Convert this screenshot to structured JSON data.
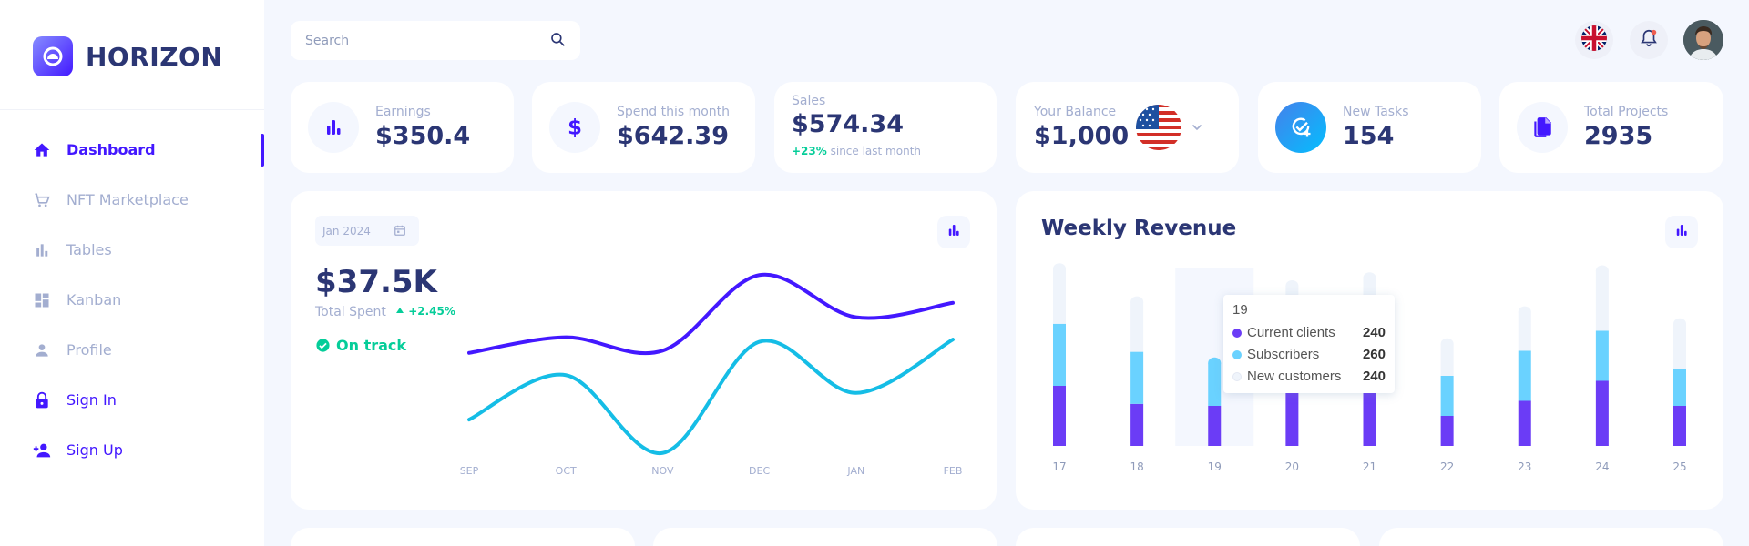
{
  "brand": {
    "name": "HORIZON"
  },
  "sidebar": {
    "items": [
      {
        "label": "Dashboard",
        "icon": "home-icon"
      },
      {
        "label": "NFT Marketplace",
        "icon": "cart-icon"
      },
      {
        "label": "Tables",
        "icon": "bar-chart-icon"
      },
      {
        "label": "Kanban",
        "icon": "dashboard-icon"
      },
      {
        "label": "Profile",
        "icon": "person-icon"
      },
      {
        "label": "Sign In",
        "icon": "lock-icon"
      },
      {
        "label": "Sign Up",
        "icon": "person-add-icon"
      }
    ],
    "active": "Dashboard"
  },
  "header": {
    "search_placeholder": "Search"
  },
  "stats": [
    {
      "label": "Earnings",
      "value": "$350.4",
      "icon": "bar-chart-icon"
    },
    {
      "label": "Spend this month",
      "value": "$642.39",
      "icon": "dollar-icon"
    },
    {
      "label": "Sales",
      "value": "$574.34",
      "change": "+23%",
      "change_text": "since last month"
    },
    {
      "label": "Your Balance",
      "value": "$1,000",
      "icon": "us-flag-icon"
    },
    {
      "label": "New Tasks",
      "value": "154",
      "icon": "task-add-icon"
    },
    {
      "label": "Total Projects",
      "value": "2935",
      "icon": "file-copy-icon"
    }
  ],
  "total_spent": {
    "date": "Jan 2024",
    "value": "$37.5K",
    "label": "Total Spent",
    "change": "+2.45%",
    "status": "On track"
  },
  "weekly_revenue": {
    "title": "Weekly Revenue",
    "tooltip": {
      "title": "19",
      "rows": [
        {
          "name": "Current clients",
          "value": "240"
        },
        {
          "name": "Subscribers",
          "value": "260"
        },
        {
          "name": "New customers",
          "value": "240"
        }
      ]
    }
  },
  "colors": {
    "primary": "#4318ff",
    "line_cyan": "#15bde6",
    "bar_purple": "#6b3cf6",
    "bar_cyan": "#6ad2ff",
    "bar_light": "#eff4fb",
    "success": "#05cd99",
    "text": "#2b3674",
    "muted": "#a3aed0"
  },
  "chart_data": [
    {
      "type": "line",
      "categories": [
        "SEP",
        "OCT",
        "NOV",
        "DEC",
        "JAN",
        "FEB"
      ],
      "series": [
        {
          "values": [
            50,
            64,
            52,
            120,
            82,
            95
          ]
        },
        {
          "values": [
            -10,
            30,
            -40,
            60,
            14,
            62
          ]
        }
      ],
      "ylim": [
        -50,
        130
      ],
      "grid": false
    },
    {
      "type": "bar",
      "stacked": true,
      "categories": [
        "17",
        "18",
        "19",
        "20",
        "21",
        "22",
        "23",
        "24",
        "25"
      ],
      "series": [
        {
          "name": "Current clients",
          "values": [
            60,
            42,
            40,
            55,
            65,
            30,
            45,
            65,
            40
          ]
        },
        {
          "name": "Subscribers",
          "values": [
            62,
            52,
            43,
            58,
            55,
            40,
            50,
            50,
            37
          ]
        },
        {
          "name": "New customers",
          "values": [
            55,
            50,
            0,
            47,
            48,
            32,
            39,
            60,
            45
          ]
        }
      ],
      "ylim": [
        0,
        200
      ],
      "highlighted": "19"
    }
  ]
}
